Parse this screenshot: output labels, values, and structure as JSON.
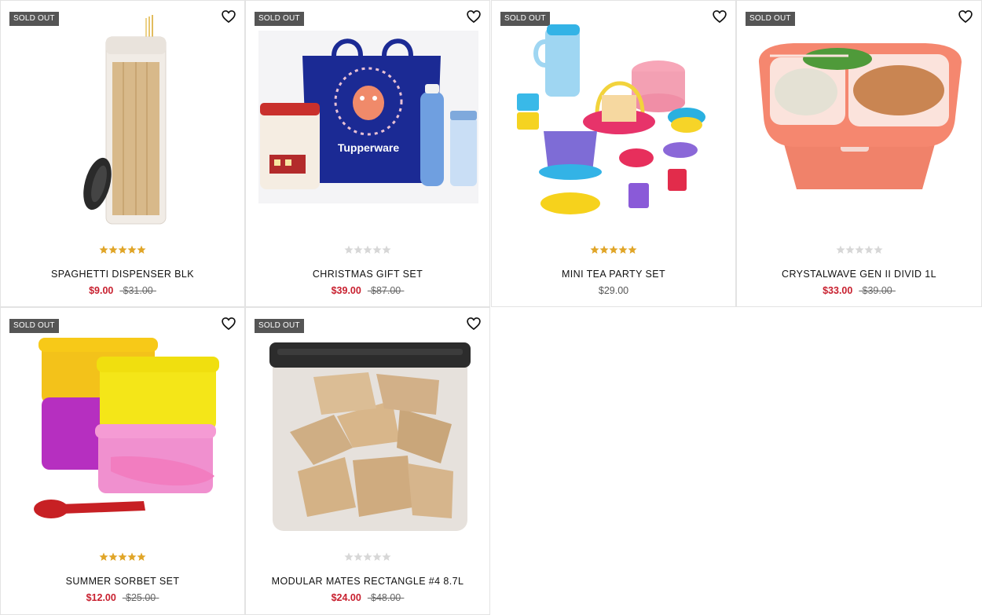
{
  "badge_label": "SOLD OUT",
  "colors": {
    "sale": "#c8202f",
    "star_filled": "#e0a528",
    "star_empty": "#d7d7d7",
    "badge_bg": "#555555"
  },
  "products": [
    {
      "name": "SPAGHETTI DISPENSER BLK",
      "sale_price": "$9.00",
      "original_price": "$31.00",
      "rating": 5,
      "sold_out": true
    },
    {
      "name": "CHRISTMAS GIFT SET",
      "sale_price": "$39.00",
      "original_price": "$87.00",
      "rating": 0,
      "sold_out": true
    },
    {
      "name": "MINI TEA PARTY SET",
      "price": "$29.00",
      "rating": 5,
      "sold_out": true
    },
    {
      "name": "CRYSTALWAVE GEN II DIVID 1L",
      "sale_price": "$33.00",
      "original_price": "$39.00",
      "rating": 0,
      "sold_out": true
    },
    {
      "name": "SUMMER SORBET SET",
      "sale_price": "$12.00",
      "original_price": "$25.00",
      "rating": 5,
      "sold_out": true
    },
    {
      "name": "MODULAR MATES RECTANGLE #4 8.7L",
      "sale_price": "$24.00",
      "original_price": "$48.00",
      "rating": 0,
      "sold_out": true
    }
  ],
  "brand_text": "Tupperware",
  "icons": {
    "wishlist": "heart-outline-icon",
    "star": "star-icon"
  }
}
